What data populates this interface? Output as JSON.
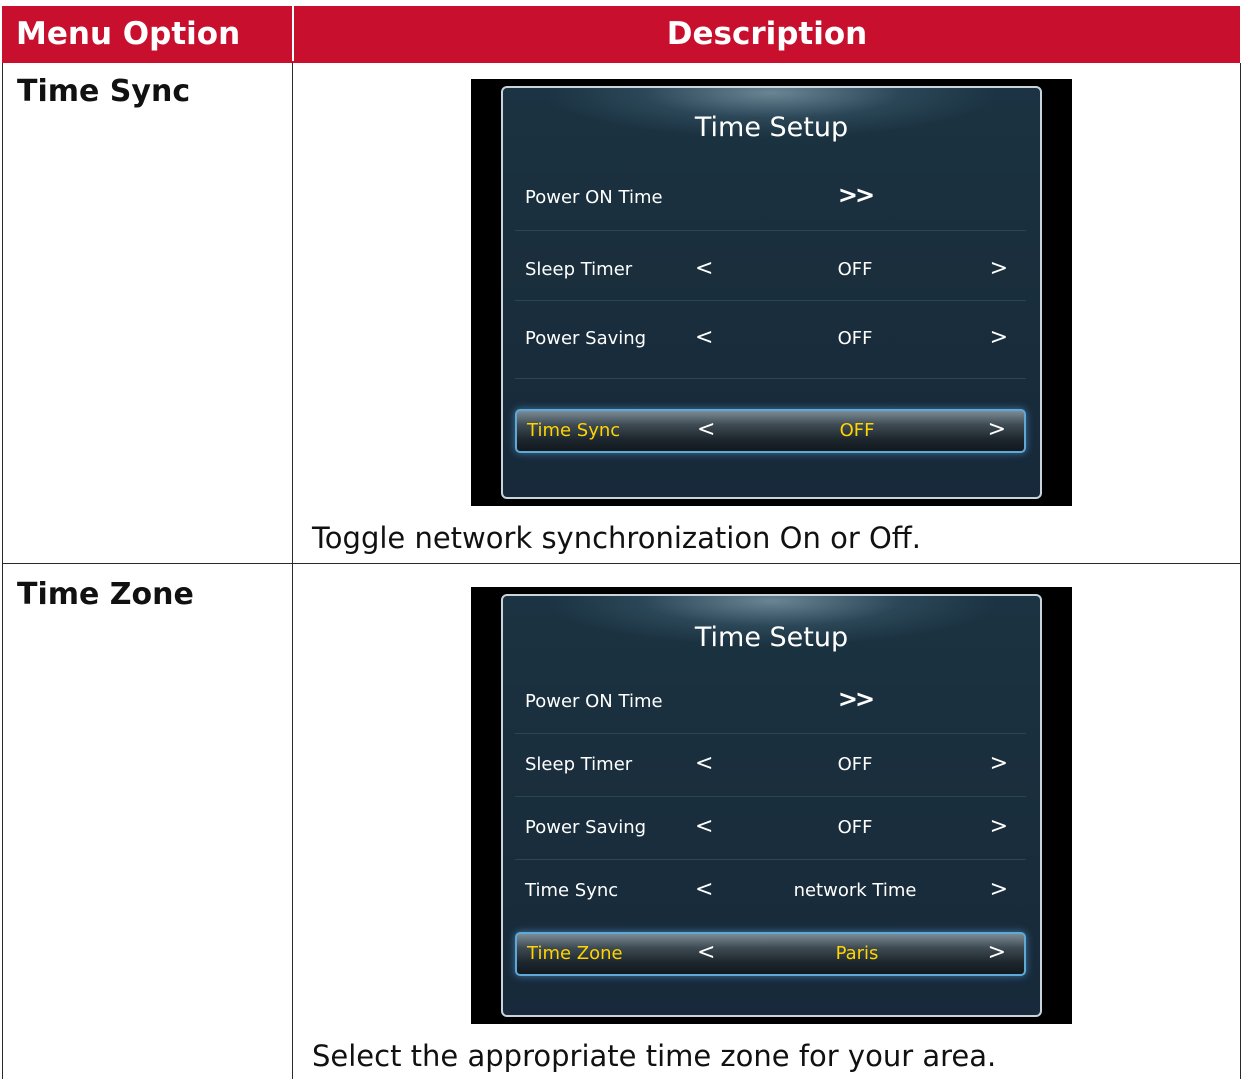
{
  "table": {
    "header": {
      "col1": "Menu Option",
      "col2": "Description"
    },
    "rows": [
      {
        "option": "Time Sync",
        "screen": {
          "title": "Time Setup",
          "items": [
            {
              "label": "Power ON Time",
              "value": "",
              "type": "submenu",
              "arrow": ">>"
            },
            {
              "label": "Sleep Timer",
              "value": "OFF",
              "type": "select",
              "left": "<",
              "right": ">"
            },
            {
              "label": "Power Saving",
              "value": "OFF",
              "type": "select",
              "left": "<",
              "right": ">"
            },
            {
              "label": "Time Sync",
              "value": "OFF",
              "type": "select",
              "left": "<",
              "right": ">",
              "selected": true
            }
          ]
        },
        "description": "Toggle network synchronization On or Off."
      },
      {
        "option": "Time Zone",
        "screen": {
          "title": "Time Setup",
          "items": [
            {
              "label": "Power ON Time",
              "value": "",
              "type": "submenu",
              "arrow": ">>"
            },
            {
              "label": "Sleep Timer",
              "value": "OFF",
              "type": "select",
              "left": "<",
              "right": ">"
            },
            {
              "label": "Power Saving",
              "value": "OFF",
              "type": "select",
              "left": "<",
              "right": ">"
            },
            {
              "label": "Time Sync",
              "value": "network Time",
              "type": "select",
              "left": "<",
              "right": ">"
            },
            {
              "label": "Time Zone",
              "value": "Paris",
              "type": "select",
              "left": "<",
              "right": ">",
              "selected": true
            }
          ]
        },
        "description": "Select the appropriate time zone for your area."
      }
    ]
  },
  "colors": {
    "header_bg": "#c8102e",
    "header_text": "#ffffff",
    "osd_selected_text": "#ffd400",
    "osd_bg": "#1a2f3d"
  }
}
